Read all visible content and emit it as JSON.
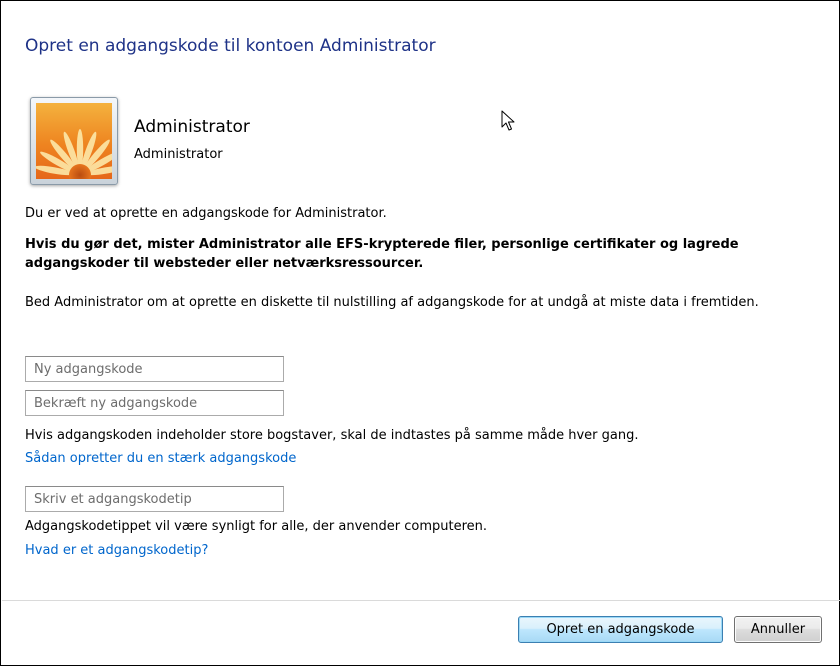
{
  "dialog": {
    "title": "Opret en adgangskode til kontoen Administrator"
  },
  "account": {
    "picture_icon": "flower-user-picture-icon",
    "name": "Administrator",
    "type": "Administrator"
  },
  "text": {
    "intro": "Du er ved at oprette en adgangskode for Administrator.",
    "warning": "Hvis du gør det, mister Administrator alle EFS-krypterede filer, personlige certifikater og lagrede adgangskoder til websteder eller netværksressourcer.",
    "advice": "Bed Administrator om at oprette en diskette til nulstilling af adgangskode for at undgå at miste data i fremtiden.",
    "case_note": "Hvis adgangskoden indeholder store bogstaver, skal de indtastes på samme måde hver gang.",
    "hint_note": "Adgangskodetippet vil være synligt for alle, der anvender computeren."
  },
  "fields": {
    "new_password": {
      "value": "",
      "placeholder": "Ny adgangskode"
    },
    "confirm_password": {
      "value": "",
      "placeholder": "Bekræft ny adgangskode"
    },
    "password_hint": {
      "value": "",
      "placeholder": "Skriv et adgangskodetip"
    }
  },
  "links": {
    "strong_password": "Sådan opretter du en stærk adgangskode",
    "what_is_hint": "Hvad er et adgangskodetip?"
  },
  "buttons": {
    "create": "Opret en adgangskode",
    "cancel": "Annuller"
  },
  "colors": {
    "title": "#1e3287",
    "link": "#0066cc"
  }
}
